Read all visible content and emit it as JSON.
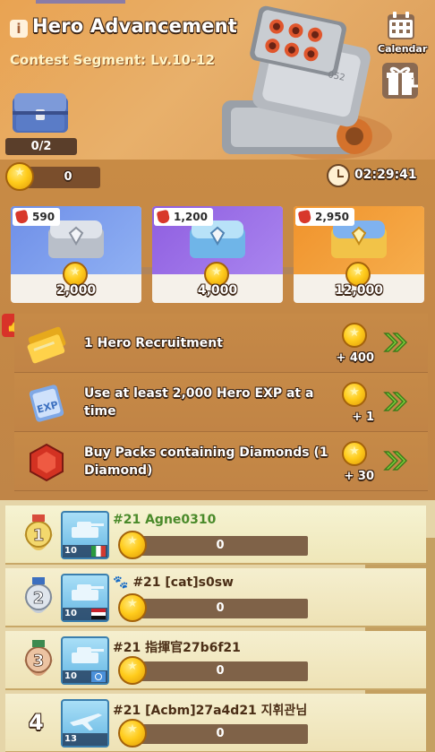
{
  "header": {
    "title": "Hero Advancement",
    "subtitle": "Contest Segment: Lv.10-12",
    "chest_progress": "0/2",
    "calendar_label": "Calendar",
    "robot_tag": "052"
  },
  "status": {
    "points": "0",
    "timer": "02:29:41"
  },
  "chests": [
    {
      "cost": "590",
      "threshold": "2,000",
      "color": "#6f8fe8"
    },
    {
      "cost": "1,200",
      "threshold": "4,000",
      "color": "#8f5ee0"
    },
    {
      "cost": "2,950",
      "threshold": "12,000",
      "color": "#f0932c"
    }
  ],
  "tasks": [
    {
      "text": "1 Hero Recruitment",
      "reward": "+ 400",
      "icon": "gold-ticket-icon"
    },
    {
      "text": "Use at least 2,000 Hero EXP at a time",
      "reward": "+ 1",
      "icon": "exp-card-icon"
    },
    {
      "text": "Buy Packs containing Diamonds (1 Diamond)",
      "reward": "+ 30",
      "icon": "ruby-icon"
    }
  ],
  "leaderboard": [
    {
      "rank": "1",
      "name": "#21 Agne0310",
      "level": "10",
      "score": "0",
      "is_self": true
    },
    {
      "rank": "2",
      "name": "#21 [cat]s0sw",
      "level": "10",
      "score": "0",
      "is_self": false
    },
    {
      "rank": "3",
      "name": "#21 指揮官27b6f21",
      "level": "10",
      "score": "0",
      "is_self": false
    },
    {
      "rank": "4",
      "name": "#21 [Acbm]27a4d21 지휘관님",
      "level": "13",
      "score": "0",
      "is_self": false
    }
  ]
}
